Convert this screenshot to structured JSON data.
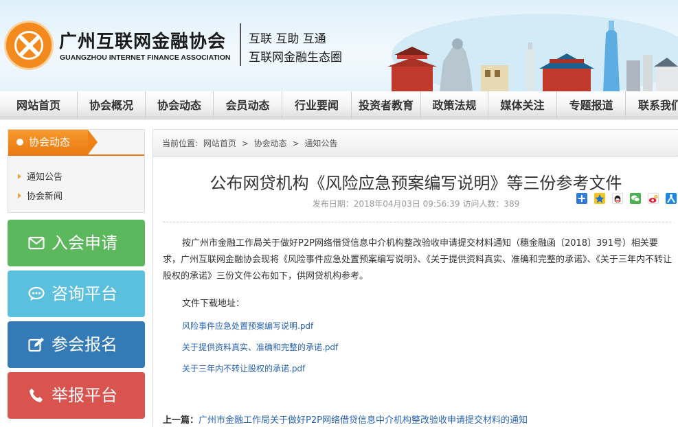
{
  "header": {
    "org_name_cn": "广州互联网金融协会",
    "org_name_en": "GUANGZHOU INTERNET FINANCE ASSOCIATION",
    "slogan_line1": "互联 互助 互通",
    "slogan_line2": "互联网金融生态圈",
    "logo_icon": "association-logo-icon",
    "banner_image": "guangzhou-skyline-illustration"
  },
  "nav": {
    "items": [
      {
        "label": "网站首页"
      },
      {
        "label": "协会概况"
      },
      {
        "label": "协会动态"
      },
      {
        "label": "会员动态"
      },
      {
        "label": "行业要闻"
      },
      {
        "label": "投资者教育"
      },
      {
        "label": "政策法规"
      },
      {
        "label": "媒体关注"
      },
      {
        "label": "专题报道"
      },
      {
        "label": "联系我们"
      }
    ]
  },
  "sidebar": {
    "section_title": "协会动态",
    "links": [
      {
        "label": "通知公告"
      },
      {
        "label": "协会新闻"
      }
    ],
    "buttons": [
      {
        "label": "入会申请",
        "icon": "envelope-icon",
        "color": "#5cb85c"
      },
      {
        "label": "咨询平台",
        "icon": "chat-bubble-icon",
        "color": "#5bc0de"
      },
      {
        "label": "参会报名",
        "icon": "edit-icon",
        "color": "#337ab7"
      },
      {
        "label": "举报平台",
        "icon": "phone-icon",
        "color": "#d9534f"
      }
    ]
  },
  "breadcrumb": {
    "prefix": "当前位置:",
    "items": [
      "网站首页",
      "协会动态",
      "通知公告"
    ],
    "separator": ">"
  },
  "article": {
    "title": "公布网贷机构《风险应急预案编写说明》等三份参考文件",
    "meta": "发布日期：2018年04月03日 09:56:39 访问人数：389",
    "share_icons": [
      "share-plus-icon",
      "qzone-icon",
      "qq-icon",
      "wechat-icon",
      "weibo-icon",
      "renren-icon"
    ],
    "body": "按广州市金融工作局关于做好P2P网络借贷信息中介机构整改验收申请提交材料通知（穗金融函〔2018〕391号）相关要求，广州互联网金融协会现将《风险事件应急处置预案编写说明》、《关于提供资料真实、准确和完整的承诺》、《关于三年内不转让股权的承诺》三份文件公布如下，供网贷机构参考。",
    "download_label": "文件下载地址：",
    "files": [
      {
        "label": "风险事件应急处置预案编写说明.pdf"
      },
      {
        "label": "关于提供资料真实、准确和完整的承诺.pdf"
      },
      {
        "label": "关于三年内不转让股权的承诺.pdf"
      }
    ],
    "prev_label": "上一篇：",
    "prev_title": "广州市金融工作局关于做好P2P网络借贷信息中介机构整改验收申请提交材料的通知"
  },
  "colors": {
    "accent_orange": "#ee8218",
    "link_blue": "#2a64b0"
  }
}
